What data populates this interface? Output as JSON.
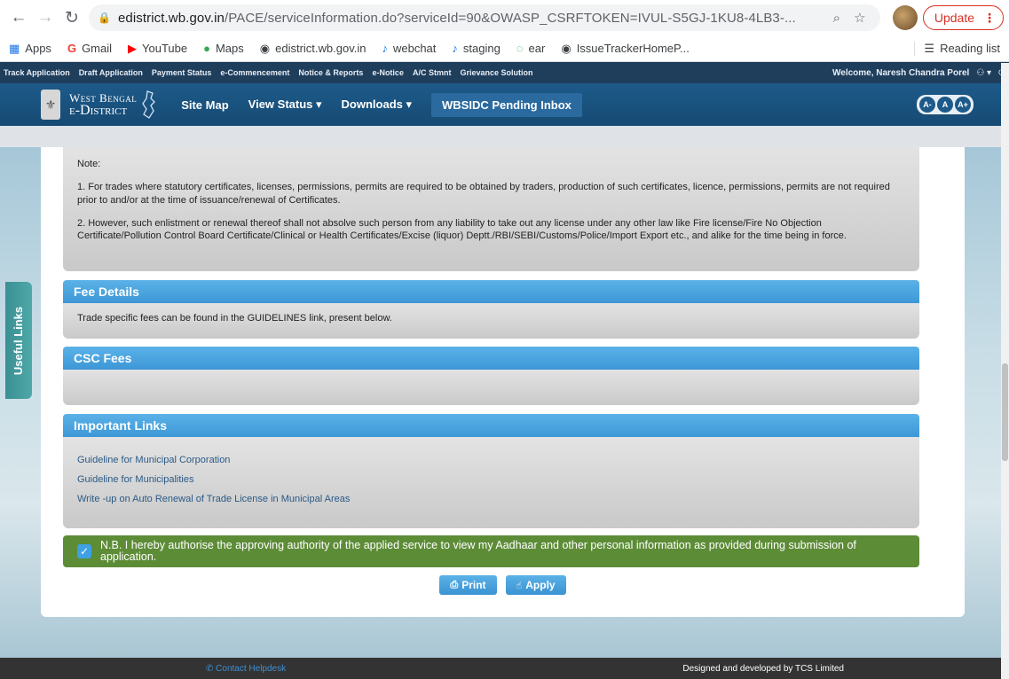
{
  "browser": {
    "url_host": "edistrict.wb.gov.in",
    "url_rest": "/PACE/serviceInformation.do?serviceId=90&OWASP_CSRFTOKEN=IVUL-S5GJ-1KU8-4LB3-...",
    "update_label": "Update",
    "bookmarks": [
      {
        "icon": "apps-icon",
        "label": "Apps"
      },
      {
        "icon": "gmail-icon",
        "label": "Gmail"
      },
      {
        "icon": "youtube-icon",
        "label": "YouTube"
      },
      {
        "icon": "maps-icon",
        "label": "Maps"
      },
      {
        "icon": "globe-icon",
        "label": "edistrict.wb.gov.in"
      },
      {
        "icon": "webchat-icon",
        "label": "webchat"
      },
      {
        "icon": "staging-icon",
        "label": "staging"
      },
      {
        "icon": "ear-icon",
        "label": "ear"
      },
      {
        "icon": "globe-icon",
        "label": "IssueTrackerHomeP..."
      }
    ],
    "reading_list": "Reading list"
  },
  "topstrip": {
    "links": [
      "Track Application",
      "Draft Application",
      "Payment Status",
      "e-Commencement",
      "Notice & Reports",
      "e-Notice",
      "A/C Stmnt",
      "Grievance Solution"
    ],
    "welcome": "Welcome, Naresh Chandra Porel"
  },
  "header": {
    "logo_line1": "West Bengal",
    "logo_line2": "e-District",
    "nav": [
      "Site Map",
      "View Status ▾",
      "Downloads ▾",
      "WBSIDC Pending Inbox"
    ],
    "font_buttons": [
      "A-",
      "A",
      "A+"
    ]
  },
  "note": {
    "title": "Note:",
    "p1": "1. For trades where statutory certificates, licenses, permissions, permits are required to be obtained by traders, production of such certificates, licence, permissions, permits are not required prior to and/or at the time of issuance/renewal of Certificates.",
    "p2": "2. However, such enlistment or renewal thereof shall not absolve such person from any liability to take out any license under any other law like Fire license/Fire No Objection Certificate/Pollution Control Board Certificate/Clinical or Health Certificates/Excise (liquor) Deptt./RBI/SEBI/Customs/Police/Import Export etc., and alike for the time being in force."
  },
  "fee_details": {
    "title": "Fee Details",
    "text": "Trade specific fees can be found in the GUIDELINES link, present below."
  },
  "csc_fees": {
    "title": "CSC Fees"
  },
  "important_links": {
    "title": "Important Links",
    "links": [
      "Guideline for Municipal Corporation",
      "Guideline for Municipalities",
      "Write -up on Auto Renewal of Trade License in Municipal Areas"
    ]
  },
  "consent": {
    "checked": true,
    "text": "N.B. I hereby authorise the approving authority of the applied service to view my Aadhaar and other personal information as provided during submission of application."
  },
  "buttons": {
    "print": "Print",
    "apply": "Apply"
  },
  "useful_links": "Useful Links",
  "footer": {
    "helpdesk": "Contact Helpdesk",
    "credit": "Designed and developed by TCS Limited"
  },
  "colors": {
    "section_header": "#3d97d6",
    "consent_bg": "#5d8c37",
    "site_header": "#1d5a8a"
  }
}
